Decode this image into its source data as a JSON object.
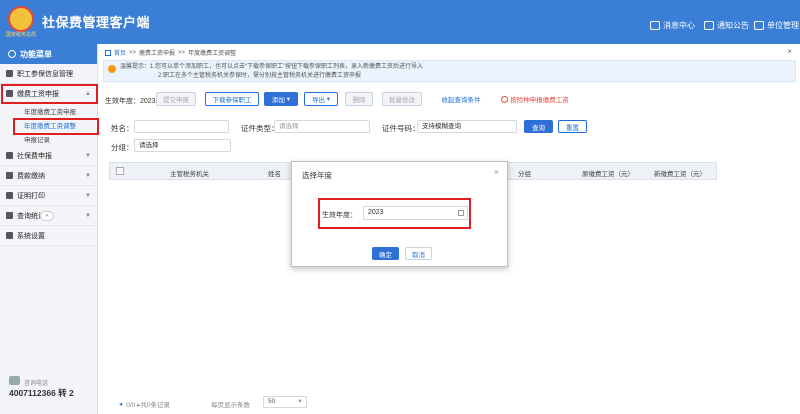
{
  "header": {
    "title": "社保费管理客户端",
    "logo_text": "国家税务总局",
    "buttons": [
      {
        "label": "消息中心",
        "icon": "bell-icon"
      },
      {
        "label": "通知公告",
        "icon": "mail-icon"
      },
      {
        "label": "单位管理",
        "icon": "building-icon"
      }
    ]
  },
  "sidebar": {
    "title": "功能菜单",
    "items": [
      {
        "label": "职工参保信息管理"
      },
      {
        "label": "缴费工资申报",
        "sub": [
          "年度缴费工资申报",
          "年度缴费工资调整",
          "申报记录"
        ]
      },
      {
        "label": "社保费申报"
      },
      {
        "label": "费款缴纳"
      },
      {
        "label": "证明打印"
      },
      {
        "label": "查询统计"
      },
      {
        "label": "系统设置"
      }
    ],
    "hotline_label": "咨询电话",
    "hotline": "4007112366 转 2"
  },
  "main": {
    "breadcrumb": [
      "首页",
      ">>",
      "缴费工资申报",
      ">>",
      "年度缴费工资调整"
    ],
    "tip_line1": "温馨提示：1.您可以单个添加职工，也可以点击“下载参保职工”按钮下载参保职工列表，录入新缴费工资后进行导入",
    "tip_line2": "2.职工在多个主管税务机关参保时，需分别按主管税务机关进行缴费工资申报",
    "year_label": "生效年度：2023",
    "toolbar": {
      "submit": "提交申报",
      "download": "下载参保职工",
      "add": "添加",
      "export": "导出",
      "delete": "删除",
      "batch_edit": "批量修改",
      "collapse_filter": "收起查询条件",
      "abnormal": "按险种申报缴费工资"
    },
    "filters": {
      "name_label": "姓名：",
      "id_type_label": "证件类型：",
      "id_type_placeholder": "请选择",
      "id_no_label": "证件号码：",
      "id_no_placeholder": "支持模糊查询",
      "group_label": "分组：",
      "group_placeholder": "请选择",
      "query": "查询",
      "reset": "重置"
    },
    "table_headers": [
      "主管税务机关",
      "姓名",
      "分组",
      "原缴费工资（元）",
      "新缴费工资（元）"
    ],
    "pager": {
      "info": "0/0 ▸共0条记录",
      "page_size_label": "每页显示条数",
      "page_size": "50"
    }
  },
  "modal": {
    "title": "选择年度",
    "label": "生效年度：",
    "value": "2023",
    "ok": "确定",
    "cancel": "取消"
  },
  "colors": {
    "primary": "#3a7fd5",
    "highlight": "#e02020"
  }
}
